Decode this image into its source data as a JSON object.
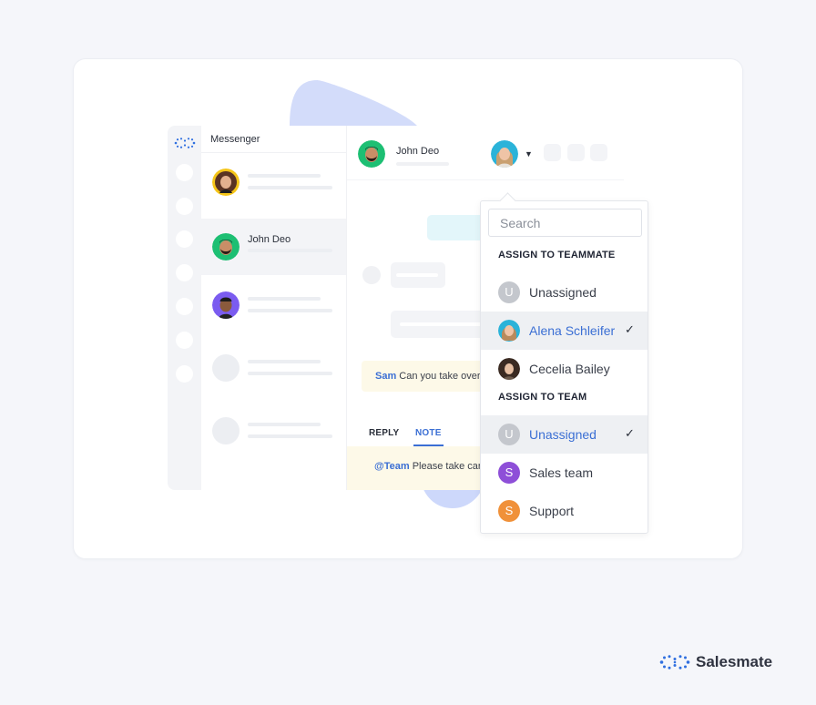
{
  "sidebar": {
    "title": "Messenger",
    "conversations": [
      {
        "name": "",
        "avatar": "woman-curly-hair",
        "avatar_ring": "#f5c518",
        "active": false
      },
      {
        "name": "John Deo",
        "avatar": "man-beard",
        "avatar_ring": "#1dbf73",
        "active": true
      },
      {
        "name": "",
        "avatar": "man-smiling",
        "avatar_ring": "#7b5cf0",
        "active": false
      },
      {
        "name": "",
        "avatar": "placeholder",
        "active": false
      },
      {
        "name": "",
        "avatar": "placeholder",
        "active": false
      }
    ]
  },
  "chat": {
    "contact_name": "John Deo",
    "contact_avatar_ring": "#1dbf73",
    "assignee_avatar_ring": "#2bb3d9",
    "note_message": {
      "mention": "Sam",
      "text": " Can you take over this"
    },
    "tabs": [
      {
        "label": "REPLY",
        "active": false
      },
      {
        "label": "NOTE",
        "active": true
      }
    ],
    "composer": {
      "mention": "@Team",
      "text": " Please take care of this"
    }
  },
  "dropdown": {
    "search_placeholder": "Search",
    "teammate_section": "ASSIGN TO TEAMMATE",
    "teammates": [
      {
        "label": "Unassigned",
        "badge": "U",
        "badge_color": "#c4c7cd",
        "selected": false
      },
      {
        "label": "Alena Schleifer",
        "photo": "woman-blonde",
        "selected": true
      },
      {
        "label": "Cecelia Bailey",
        "photo": "woman-dark-hair",
        "selected": false
      }
    ],
    "team_section": "ASSIGN TO TEAM",
    "teams": [
      {
        "label": "Unassigned",
        "badge": "U",
        "badge_color": "#c4c7cd",
        "selected": true
      },
      {
        "label": "Sales team",
        "badge": "S",
        "badge_color": "#8e4fd8",
        "selected": false
      },
      {
        "label": "Support",
        "badge": "S",
        "badge_color": "#f0913a",
        "selected": false
      }
    ],
    "check_glyph": "✓"
  },
  "brand": {
    "name": "Salesmate",
    "color": "#2f6fe0"
  },
  "colors": {
    "accent": "#3b6fd4",
    "note_bg": "#fdf9e8",
    "blob": "#d3dcfa"
  }
}
